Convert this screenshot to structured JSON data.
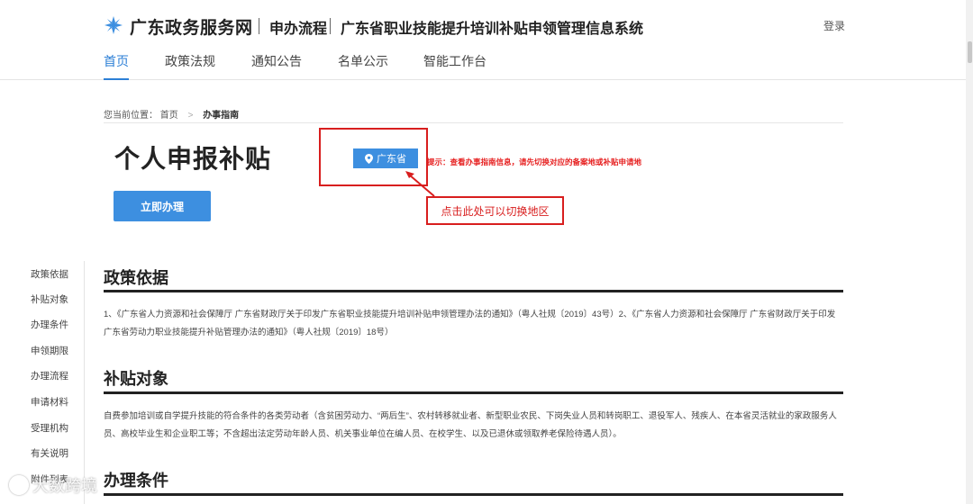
{
  "header": {
    "brand": "广东政务服务网",
    "section": "申办流程",
    "system_title": "广东省职业技能提升培训补贴申领管理信息系统",
    "login": "登录"
  },
  "nav": {
    "items": [
      "首页",
      "政策法规",
      "通知公告",
      "名单公示",
      "智能工作台"
    ],
    "active": "首页"
  },
  "location": {
    "prefix": "您当前位置：",
    "home": "首页",
    "separator": ">",
    "current": "办事指南"
  },
  "page": {
    "title": "个人申报补贴",
    "region_button": "广东省",
    "tip": "提示：查看办事指南信息，请先切换对应的备案地或补贴申请地",
    "callout": "点击此处可以切换地区",
    "apply_button": "立即办理"
  },
  "side_nav": [
    "政策依据",
    "补贴对象",
    "办理条件",
    "申领期限",
    "办理流程",
    "申请材料",
    "受理机构",
    "有关说明",
    "附件列表"
  ],
  "sections": [
    {
      "title": "政策依据",
      "text": "1、《广东省人力资源和社会保障厅 广东省财政厅关于印发广东省职业技能提升培训补贴申领管理办法的通知》（粤人社规〔2019〕43号）2、《广东省人力资源和社会保障厅 广东省财政厅关于印发广东省劳动力职业技能提升补贴管理办法的通知》（粤人社规〔2019〕18号）"
    },
    {
      "title": "补贴对象",
      "text": "自费参加培训或自学提升技能的符合条件的各类劳动者（含贫困劳动力、“两后生”、农村转移就业者、新型职业农民、下岗失业人员和转岗职工、退役军人、残疾人、在本省灵活就业的家政服务人员、高校毕业生和企业职工等；不含超出法定劳动年龄人员、机关事业单位在编人员、在校学生、以及已退休或领取养老保险待遇人员）。"
    },
    {
      "title": "办理条件",
      "text": ""
    }
  ],
  "watermark": "大数跨境",
  "colors": {
    "accent": "#3d8fe0",
    "annotation_red": "#d81e1e"
  }
}
